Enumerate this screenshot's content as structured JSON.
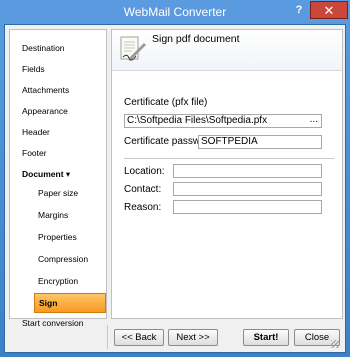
{
  "window": {
    "title": "WebMail Converter",
    "help_label": "?",
    "close_label": "✕"
  },
  "sidebar": {
    "items": [
      {
        "label": "Destination"
      },
      {
        "label": "Fields"
      },
      {
        "label": "Attachments"
      },
      {
        "label": "Appearance"
      },
      {
        "label": "Header"
      },
      {
        "label": "Footer"
      },
      {
        "label": "Document ▾"
      }
    ],
    "sub_items": [
      {
        "label": "Paper size"
      },
      {
        "label": "Margins"
      },
      {
        "label": "Properties"
      },
      {
        "label": "Compression"
      },
      {
        "label": "Encryption"
      },
      {
        "label": "Sign"
      }
    ],
    "start_label": "Start conversion",
    "active": "Sign"
  },
  "content": {
    "header_title": "Sign pdf document",
    "certificate_label": "Certificate (pfx file)",
    "certificate_value": "C:\\Softpedia Files\\Softpedia.pfx",
    "browse_label": "...",
    "password_label": "Certificate password",
    "password_value": "SOFTPEDIA",
    "location_label": "Location:",
    "location_value": "",
    "contact_label": "Contact:",
    "contact_value": "",
    "reason_label": "Reason:",
    "reason_value": ""
  },
  "buttons": {
    "back_label": "<< Back",
    "next_label": "Next >>",
    "start_label": "Start!",
    "close_label": "Close"
  },
  "colors": {
    "title_bar": "#4f8fd0",
    "active_nav": "#f89a1e",
    "close_button": "#c9483b"
  }
}
